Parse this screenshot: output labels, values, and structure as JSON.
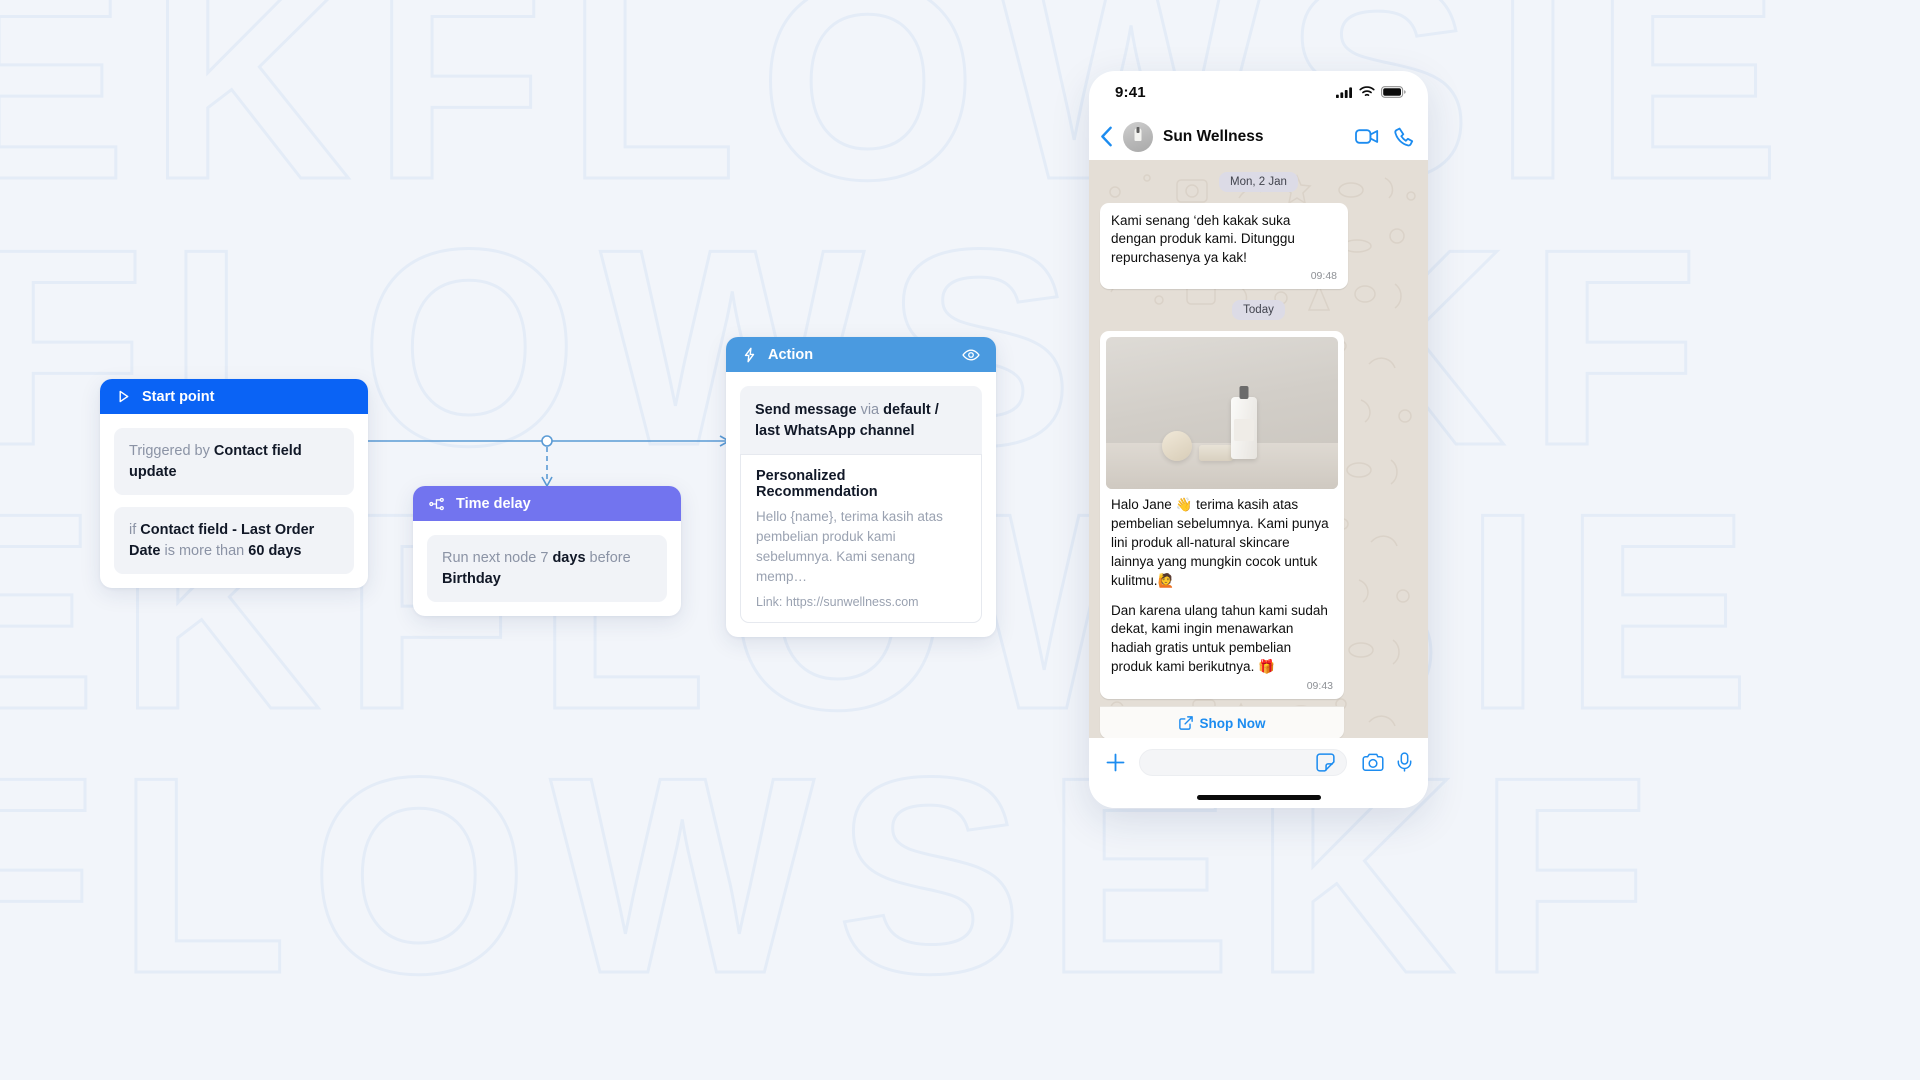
{
  "background": {
    "watermark_text": "KFLOWS",
    "watermark_rows": [
      "EKFLOWSIE",
      "KFLOWSEKF",
      "EKFLOWSIE",
      "KFLOWSEKF"
    ],
    "canvas_color": "#f2f5fa",
    "watermark_color": "#e4ecf7"
  },
  "flow": {
    "nodes": [
      {
        "id": "start-point",
        "title": "Start point",
        "icon": "play-triangle-icon",
        "header_color": "#0a63f5",
        "rows": [
          {
            "prefix": "Triggered by ",
            "bold": "Contact field update",
            "suffix": ""
          },
          {
            "prefix": "if ",
            "bold": "Contact field - Last Order Date",
            "mid": " is more than ",
            "bold2": "60 days"
          }
        ]
      },
      {
        "id": "time-delay",
        "title": "Time delay",
        "icon": "node-hierarchy-icon",
        "header_color": "#7274ef",
        "rows": [
          {
            "prefix": "Run next node 7 ",
            "bold": "days",
            "mid": " before ",
            "bold2": "Birthday"
          }
        ]
      },
      {
        "id": "action",
        "title": "Action",
        "icon": "lightning-bolt-icon",
        "header_action_icon": "eye-icon",
        "header_color": "#4a9ae0",
        "send_prefix": "Send message ",
        "send_via": "via ",
        "send_channel": "default / last WhatsApp channel",
        "card_title": "Personalized Recommendation",
        "card_preview": "Hello {name}, terima kasih atas pembelian produk  kami sebelumnya. Kami senang memp…",
        "card_link": "Link: https://sunwellness.com"
      }
    ],
    "connector_color": "#5b9bd5"
  },
  "phone": {
    "status_bar": {
      "time": "9:41",
      "icons": [
        "signal-bars-icon",
        "wifi-icon",
        "battery-icon"
      ]
    },
    "chat_header": {
      "back_icon": "back-chevron-icon",
      "avatar": "contact-avatar",
      "name": "Sun Wellness",
      "actions": [
        "video-call-icon",
        "phone-call-icon"
      ]
    },
    "conversation": [
      {
        "type": "date-chip",
        "label": "Mon, 2 Jan"
      },
      {
        "type": "text-bubble",
        "text": "Kami senang ‘deh kakak suka dengan produk kami. Ditunggu repurchasenya ya kak!",
        "time": "09:48"
      },
      {
        "type": "date-chip",
        "label": "Today"
      },
      {
        "type": "media-bubble",
        "image_alt": "skincare-product-photo",
        "paragraphs": [
          "Halo Jane 👋 terima kasih atas pembelian sebelumnya. Kami punya lini produk all-natural skincare lainnya yang mungkin cocok untuk kulitmu.🙋",
          "Dan karena ulang tahun kami sudah dekat, kami ingin menawarkan hadiah gratis untuk pembelian produk kami berikutnya. 🎁"
        ],
        "time": "09:43",
        "cta_label": "Shop Now",
        "cta_icon": "external-link-icon"
      }
    ],
    "input_bar": {
      "plus_icon": "plus-icon",
      "placeholder": "",
      "icons": [
        "sticker-icon",
        "camera-icon",
        "microphone-icon"
      ]
    },
    "accent_color": "#1c8cf0",
    "wallpaper_color": "#e4ded6"
  }
}
